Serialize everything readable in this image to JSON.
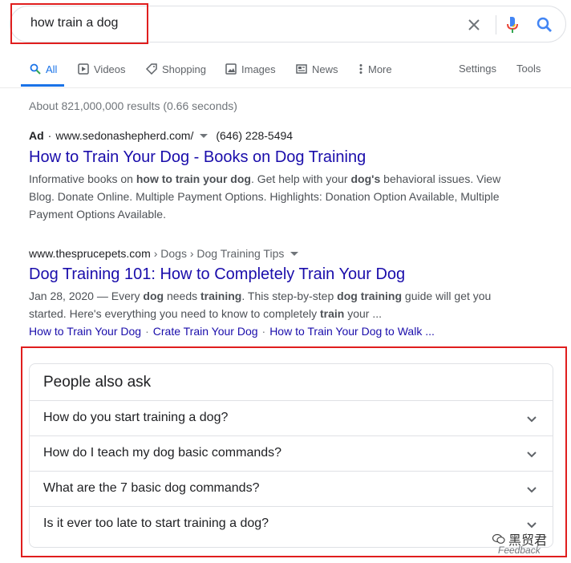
{
  "search": {
    "query": "how train a dog",
    "icons": {
      "clear": "close-icon",
      "voice": "mic-icon",
      "submit": "search-icon"
    }
  },
  "tabs": [
    {
      "label": "All",
      "icon": "search-icon",
      "active": true
    },
    {
      "label": "Videos",
      "icon": "video-icon"
    },
    {
      "label": "Shopping",
      "icon": "tag-icon"
    },
    {
      "label": "Images",
      "icon": "image-icon"
    },
    {
      "label": "News",
      "icon": "news-icon"
    },
    {
      "label": "More",
      "icon": "more-vert-icon"
    }
  ],
  "tools": {
    "settings": "Settings",
    "tools": "Tools"
  },
  "stats": "About 821,000,000 results (0.66 seconds)",
  "ad": {
    "label": "Ad",
    "dot": "·",
    "url": "www.sedonashepherd.com/",
    "phone": "(646) 228-5494",
    "title": "How to Train Your Dog - Books on Dog Training",
    "snippet_html": "Informative books on <b>how to train your dog</b>. Get help with your <b>dog's</b> behavioral issues. View Blog. Donate Online. Multiple Payment Options. Highlights: Donation Option Available, Multiple Payment Options Available."
  },
  "result": {
    "site": "www.thesprucepets.com",
    "breadcrumb": "› Dogs › Dog Training Tips",
    "title": "Dog Training 101: How to Completely Train Your Dog",
    "snippet_html": "Jan 28, 2020 — Every <b>dog</b> needs <b>training</b>. This step-by-step <b>dog training</b> guide will get you started. Here's everything you need to know to completely <b>train</b> your ...",
    "sublinks": [
      "How to Train Your Dog",
      "Crate Train Your Dog",
      "How to Train Your Dog to Walk ..."
    ],
    "sublink_sep": "·"
  },
  "paa": {
    "heading": "People also ask",
    "questions": [
      "How do you start training a dog?",
      "How do I teach my dog basic commands?",
      "What are the 7 basic dog commands?",
      "Is it ever too late to start training a dog?"
    ]
  },
  "watermark": "黑贸君",
  "feedback": "Feedback",
  "colors": {
    "link": "#1a0dab",
    "accent": "#1a73e8",
    "highlight_box": "#e01e1e"
  }
}
